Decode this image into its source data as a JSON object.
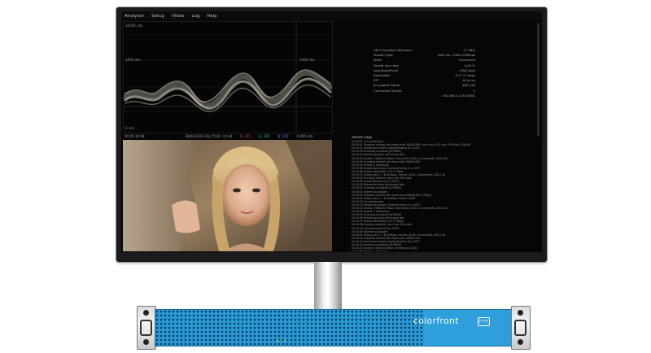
{
  "menu": {
    "items": [
      "Analyzer",
      "Setup",
      "Video",
      "Log",
      "Help"
    ]
  },
  "waveform": {
    "label_top": "10000 nits",
    "label_mid_left": "1000 nits",
    "label_mid_right": "1000 nits",
    "label_bottom": "0 nits"
  },
  "status_bar": {
    "timecode": "00:05:10:08",
    "format": "3840x2160 24p YCbCr 10 bit",
    "r": "R: 245",
    "g": "G: 229",
    "b": "B: 420",
    "nits": "0.800 nits"
  },
  "stats": [
    {
      "key": "GPU Encoding Utilization",
      "value": "17.08%"
    },
    {
      "key": "Stream Type",
      "value": "UHD res. 10bit 100Mbps"
    },
    {
      "key": "State",
      "value": "Connected"
    },
    {
      "key": "Packet loss ratio",
      "value": "0.00 %"
    },
    {
      "key": "Loss/Drop/Panel",
      "value": "0/0/0 pkts"
    },
    {
      "key": "Bandwidth",
      "value": "115.77 mbps"
    },
    {
      "key": "RTT",
      "value": "8.5e ms"
    },
    {
      "key": "Encryption Mode",
      "value": "AES-128"
    },
    {
      "key": "Connected Clients",
      "value": "1"
    },
    {
      "key": "",
      "value": "192.168.x.118:50561"
    }
  ],
  "log": {
    "title": "Stream Logs",
    "lines": [
      "04.39:41 Connected peer",
      "04.39:41 Encoding started with frame size 3840x2160, input rate 100, max 150 kbits 2160x/8",
      "04.39:41 Streaming started, Authenticating 10.x.1007",
      "04.39:43 Licensing accepted [LICENSE]",
      "04.39:43 Streaming input and output pkts",
      "04.39:44 Quality: 1080p 30 Mbps, Frames/Sec 24/24, 0 bandwidth, AES-128",
      "04.39:45 Encoding started with frame size 3840x2160",
      "04.39:45 Stream 1 streaming",
      "04.39:46 Streaming started, Authenticating 10.x.1007",
      "04.39:46 Output bandwidth 115.77 Mbps",
      "04.39:47 Output port 1, 18.44 Mbps, frames 24/24, 0 bandwidth, AES-128",
      "04.39:47 Encoding started, input rate 100 kbits",
      "04.39:48 Connected peer [10.x.1007]",
      "04.39:49 Streaming input and output pkts",
      "04.39:50 Licensing accepted [LICENSE]",
      "04.39:51 Streaming stopped",
      "04.39:52 Encoding started with frame size 3840x2160 [1080p]",
      "04.39:52 Output port 1, 18.44 Mbps, frames 24/24",
      "04.39:53 Connected peer",
      "04.39:53 Streaming started, Authenticating 10.x.1007",
      "04.39:54 Quality: 1080p 30 Mbps, Frames/Sec 24/24, 0 bandwidth, AES-128",
      "04.39:55 Stream 1 streaming",
      "04.39:55 Licensing accepted [LICENSE]",
      "04.39:56 Streaming input and output pkts",
      "04.39:57 Output bandwidth 115.77 Mbps",
      "04.39:58 Encoding started, input rate 100 kbits",
      "04.39:59 Connected peer [10.x.1007]",
      "04.40:00 Streaming stopped",
      "04.40:01 Output port 1, 18.44 Mbps, frames 24/24, 0 bandwidth, AES-128",
      "04.40:02 Encoding started with frame size 3840x2160",
      "04.40:03 Streaming started, Authenticating 10.x.1007",
      "04.40:04 Licensing accepted [LICENSE]",
      "04.40:05 Quality: 1080p 30 Mbps, Frames/Sec 24/24",
      "04.40:06 Stream 1 streaming"
    ]
  },
  "device": {
    "brand": "colorfront",
    "badge": "|>>|"
  },
  "colors": {
    "device_blue": "#2a9bd6",
    "screen_bg": "#060606"
  }
}
